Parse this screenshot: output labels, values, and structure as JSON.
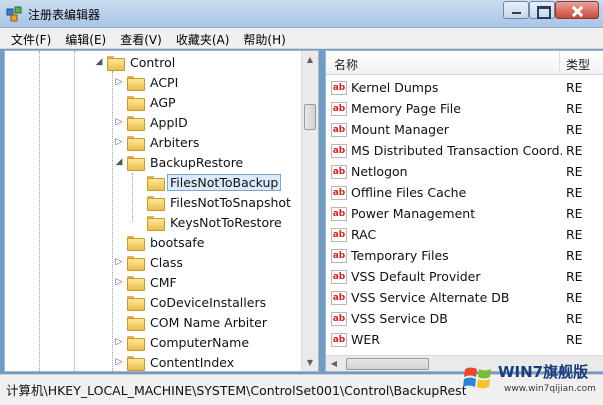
{
  "window": {
    "title": "注册表编辑器",
    "icon": "regedit-icon"
  },
  "menu": [
    "文件(F)",
    "编辑(E)",
    "查看(V)",
    "收藏夹(A)",
    "帮助(H)"
  ],
  "tree": {
    "items": [
      {
        "label": "Control",
        "depth": 0,
        "expander": "expanded"
      },
      {
        "label": "ACPI",
        "depth": 1,
        "expander": "collapsed"
      },
      {
        "label": "AGP",
        "depth": 1,
        "expander": "none"
      },
      {
        "label": "AppID",
        "depth": 1,
        "expander": "collapsed"
      },
      {
        "label": "Arbiters",
        "depth": 1,
        "expander": "collapsed"
      },
      {
        "label": "BackupRestore",
        "depth": 1,
        "expander": "expanded"
      },
      {
        "label": "FilesNotToBackup",
        "depth": 2,
        "expander": "none",
        "selected": true
      },
      {
        "label": "FilesNotToSnapshot",
        "depth": 2,
        "expander": "none"
      },
      {
        "label": "KeysNotToRestore",
        "depth": 2,
        "expander": "none"
      },
      {
        "label": "bootsafe",
        "depth": 1,
        "expander": "none"
      },
      {
        "label": "Class",
        "depth": 1,
        "expander": "collapsed"
      },
      {
        "label": "CMF",
        "depth": 1,
        "expander": "collapsed"
      },
      {
        "label": "CoDeviceInstallers",
        "depth": 1,
        "expander": "none"
      },
      {
        "label": "COM Name Arbiter",
        "depth": 1,
        "expander": "none"
      },
      {
        "label": "ComputerName",
        "depth": 1,
        "expander": "collapsed"
      },
      {
        "label": "ContentIndex",
        "depth": 1,
        "expander": "collapsed"
      }
    ]
  },
  "values": {
    "header_name": "名称",
    "header_type": "类型",
    "rows": [
      {
        "name": "Kernel Dumps",
        "type": "RE"
      },
      {
        "name": "Memory Page File",
        "type": "RE"
      },
      {
        "name": "Mount Manager",
        "type": "RE"
      },
      {
        "name": "MS Distributed Transaction Coord...",
        "type": "RE"
      },
      {
        "name": "Netlogon",
        "type": "RE"
      },
      {
        "name": "Offline Files Cache",
        "type": "RE"
      },
      {
        "name": "Power Management",
        "type": "RE"
      },
      {
        "name": "RAC",
        "type": "RE"
      },
      {
        "name": "Temporary Files",
        "type": "RE"
      },
      {
        "name": "VSS Default Provider",
        "type": "RE"
      },
      {
        "name": "VSS Service Alternate DB",
        "type": "RE"
      },
      {
        "name": "VSS Service DB",
        "type": "RE"
      },
      {
        "name": "WER",
        "type": "RE"
      }
    ],
    "value_icon": "ab",
    "icon_color": "#c8281e"
  },
  "status": {
    "path": "计算机\\HKEY_LOCAL_MACHINE\\SYSTEM\\ControlSet001\\Control\\BackupRestore\\FilesNotToBackup"
  },
  "watermark": {
    "text": "WIN7旗舰版",
    "url": "www.win7qijian.com"
  }
}
